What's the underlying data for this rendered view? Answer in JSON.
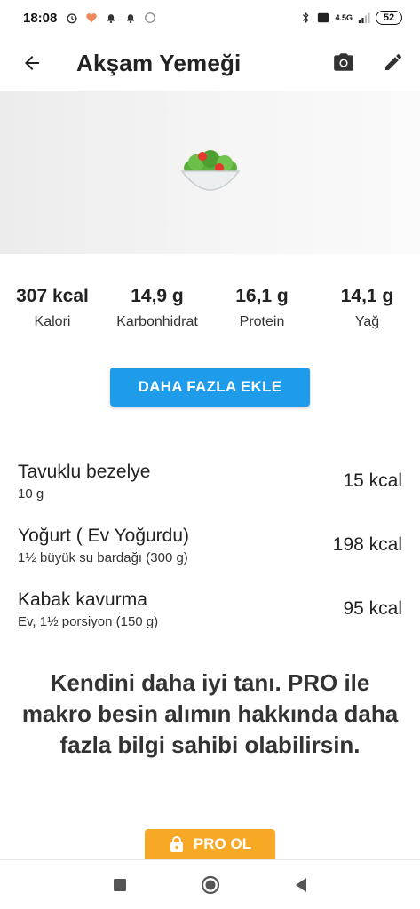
{
  "status_bar": {
    "time": "18:08",
    "network": "4.5G",
    "battery": "52"
  },
  "app_bar": {
    "title": "Akşam Yemeği"
  },
  "hero": {
    "emoji": "🥗"
  },
  "macros": [
    {
      "value": "307 kcal",
      "label": "Kalori"
    },
    {
      "value": "14,9 g",
      "label": "Karbonhidrat"
    },
    {
      "value": "16,1 g",
      "label": "Protein"
    },
    {
      "value": "14,1 g",
      "label": "Yağ"
    }
  ],
  "add_more_label": "DAHA FAZLA EKLE",
  "foods": [
    {
      "name": "Tavuklu bezelye",
      "detail": "10 g",
      "kcal": "15 kcal"
    },
    {
      "name": "Yoğurt ( Ev Yoğurdu)",
      "detail": "1½ büyük su bardağı (300 g)",
      "kcal": "198 kcal"
    },
    {
      "name": "Kabak kavurma",
      "detail": "Ev, 1½ porsiyon (150 g)",
      "kcal": "95 kcal"
    }
  ],
  "promo": {
    "text": "Kendini daha iyi tanı. PRO ile makro besin alımın hakkında daha fazla bilgi sahibi olabilirsin.",
    "button_label": "PRO OL"
  },
  "colors": {
    "primary_button": "#1e9be9",
    "pro_button": "#f7a825"
  }
}
